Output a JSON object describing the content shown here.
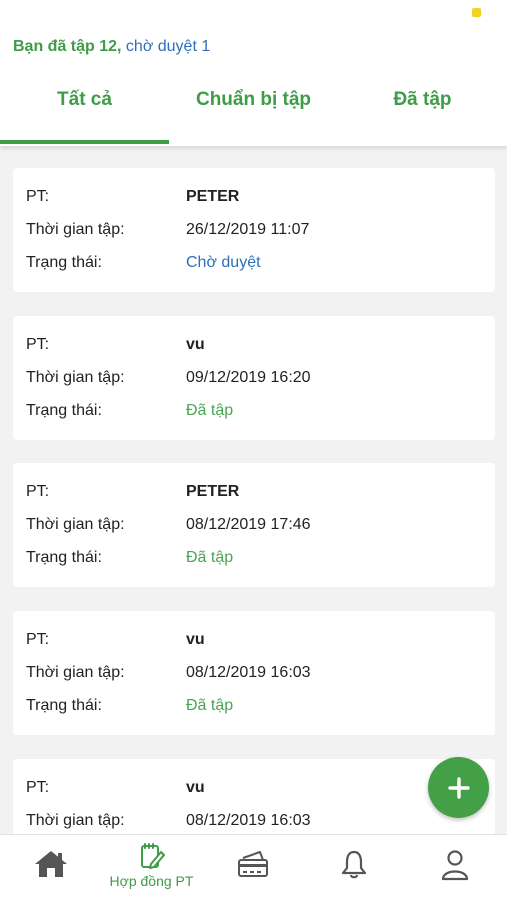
{
  "header": {
    "summary_done": "Bạn đã tập 12",
    "summary_sep": ", ",
    "summary_pending": "chờ duyệt 1"
  },
  "tabs": [
    {
      "label": "Tất cả",
      "active": true
    },
    {
      "label": "Chuẩn bị tập",
      "active": false
    },
    {
      "label": "Đã tập",
      "active": false
    }
  ],
  "labels": {
    "pt": "PT:",
    "time": "Thời gian tập:",
    "status": "Trạng thái:"
  },
  "sessions": [
    {
      "pt": "PETER",
      "time": "26/12/2019 11:07",
      "status": "Chờ duyệt"
    },
    {
      "pt": "vu",
      "time": "09/12/2019 16:20",
      "status": "Đã tập"
    },
    {
      "pt": "PETER",
      "time": "08/12/2019 17:46",
      "status": "Đã tập"
    },
    {
      "pt": "vu",
      "time": "08/12/2019 16:03",
      "status": "Đã tập"
    },
    {
      "pt": "vu",
      "time": "08/12/2019 16:03",
      "status": ""
    }
  ],
  "fab": {
    "icon": "plus-icon"
  },
  "bottom_nav": [
    {
      "icon": "home-icon",
      "label": ""
    },
    {
      "icon": "contract-icon",
      "label": "Hợp đồng PT"
    },
    {
      "icon": "card-icon",
      "label": ""
    },
    {
      "icon": "bell-icon",
      "label": ""
    },
    {
      "icon": "user-icon",
      "label": ""
    }
  ],
  "colors": {
    "accent": "#3f9c48",
    "pending": "#2f6fba",
    "done": "#4aa552",
    "fab": "#43a047",
    "background": "#f2f2f2"
  }
}
